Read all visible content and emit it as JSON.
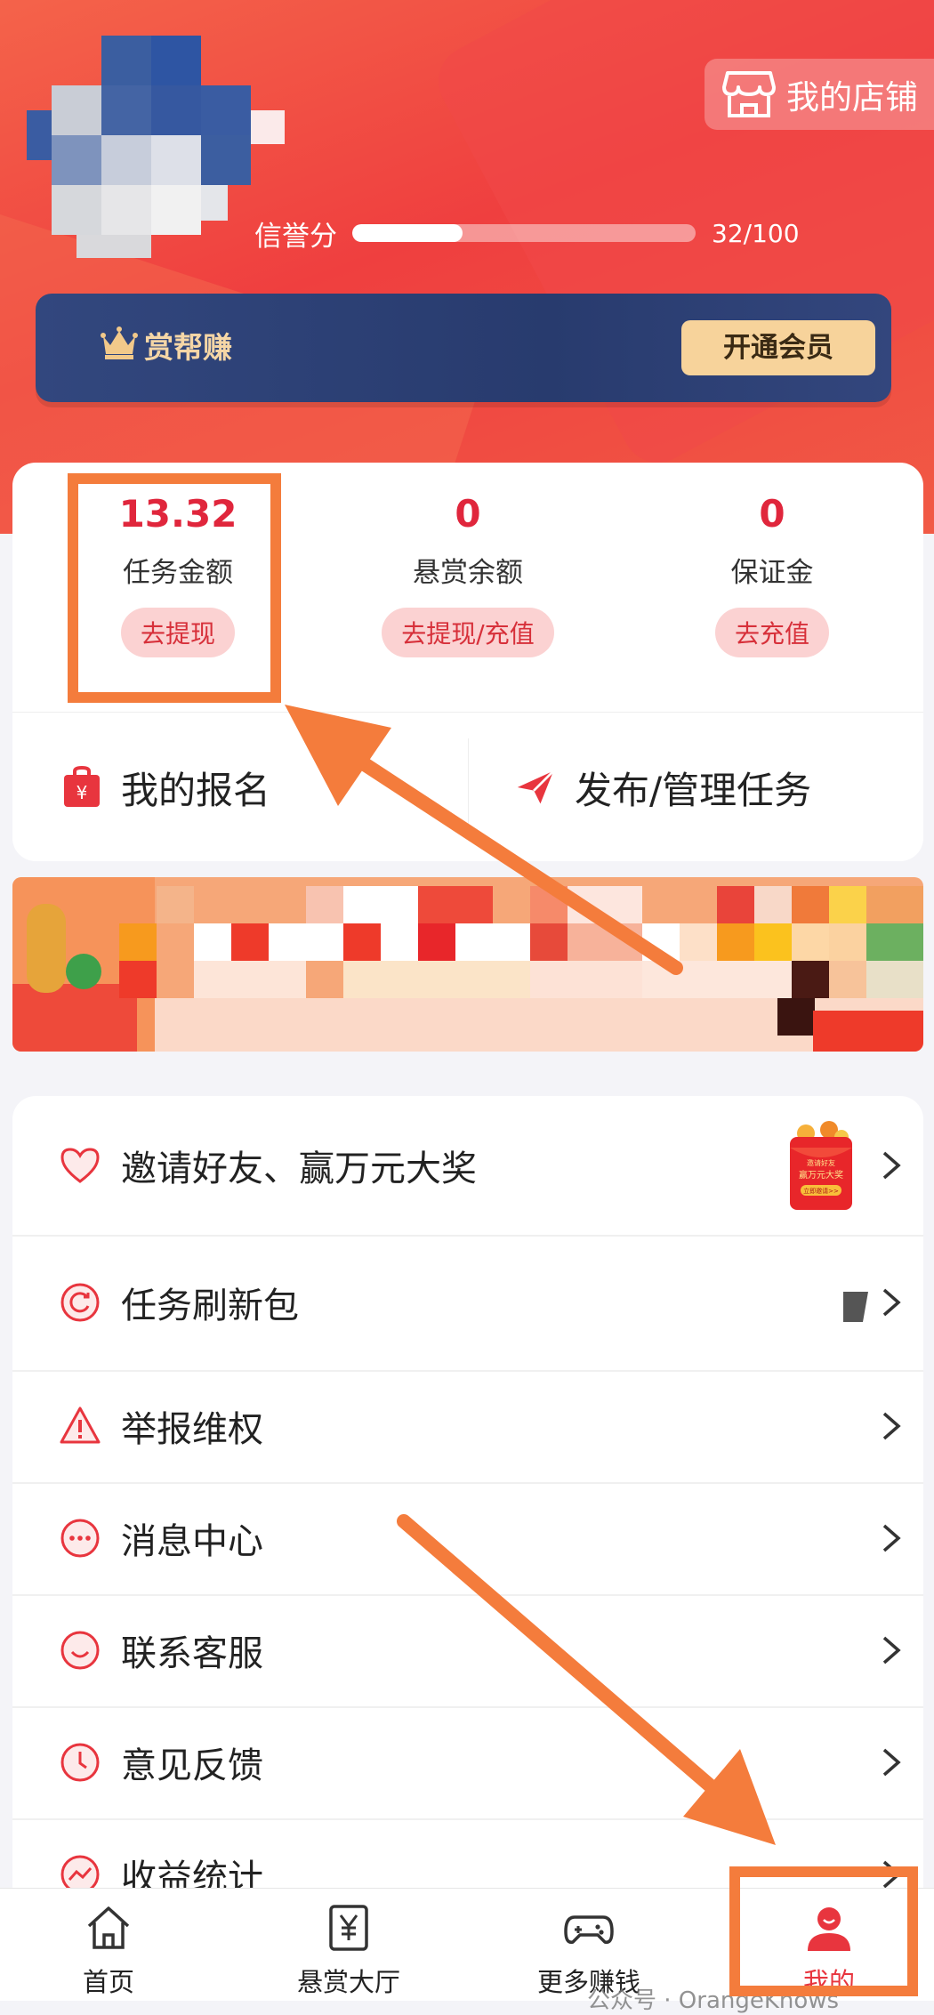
{
  "header": {
    "store_button_label": "我的店铺",
    "credit": {
      "label": "信誉分",
      "current": 32,
      "max": 100,
      "text": "32/100"
    }
  },
  "vip": {
    "name": "赏帮赚",
    "button_label": "开通会员"
  },
  "balances": [
    {
      "amount": "13.32",
      "label": "任务金额",
      "button": "去提现"
    },
    {
      "amount": "0",
      "label": "悬赏余额",
      "button": "去提现/充值"
    },
    {
      "amount": "0",
      "label": "保证金",
      "button": "去充值"
    }
  ],
  "actions": {
    "my_signup": "我的报名",
    "publish_manage": "发布/管理任务"
  },
  "menu": [
    {
      "label": "邀请好友、赢万元大奖",
      "icon": "heart-icon"
    },
    {
      "label": "任务刷新包",
      "icon": "refresh-icon"
    },
    {
      "label": "举报维权",
      "icon": "warning-icon"
    },
    {
      "label": "消息中心",
      "icon": "message-icon"
    },
    {
      "label": "联系客服",
      "icon": "customer-service-icon"
    },
    {
      "label": "意见反馈",
      "icon": "clock-icon"
    },
    {
      "label": "收益统计",
      "icon": "chart-icon"
    }
  ],
  "promo": {
    "line1": "邀请好友",
    "line2": "赢万元大奖",
    "line3": "立即邀请>>"
  },
  "tabs": [
    {
      "label": "首页",
      "icon": "home-icon"
    },
    {
      "label": "悬赏大厅",
      "icon": "yuan-icon"
    },
    {
      "label": "更多赚钱",
      "icon": "gamepad-icon"
    },
    {
      "label": "我的",
      "icon": "user-icon",
      "active": true
    }
  ],
  "watermark": "公众号 · OrangeKnows",
  "colors": {
    "accent": "#e8353e",
    "annotation": "#f47c3c",
    "vip_bg": "#2d4173",
    "vip_gold": "#f7d39b"
  }
}
